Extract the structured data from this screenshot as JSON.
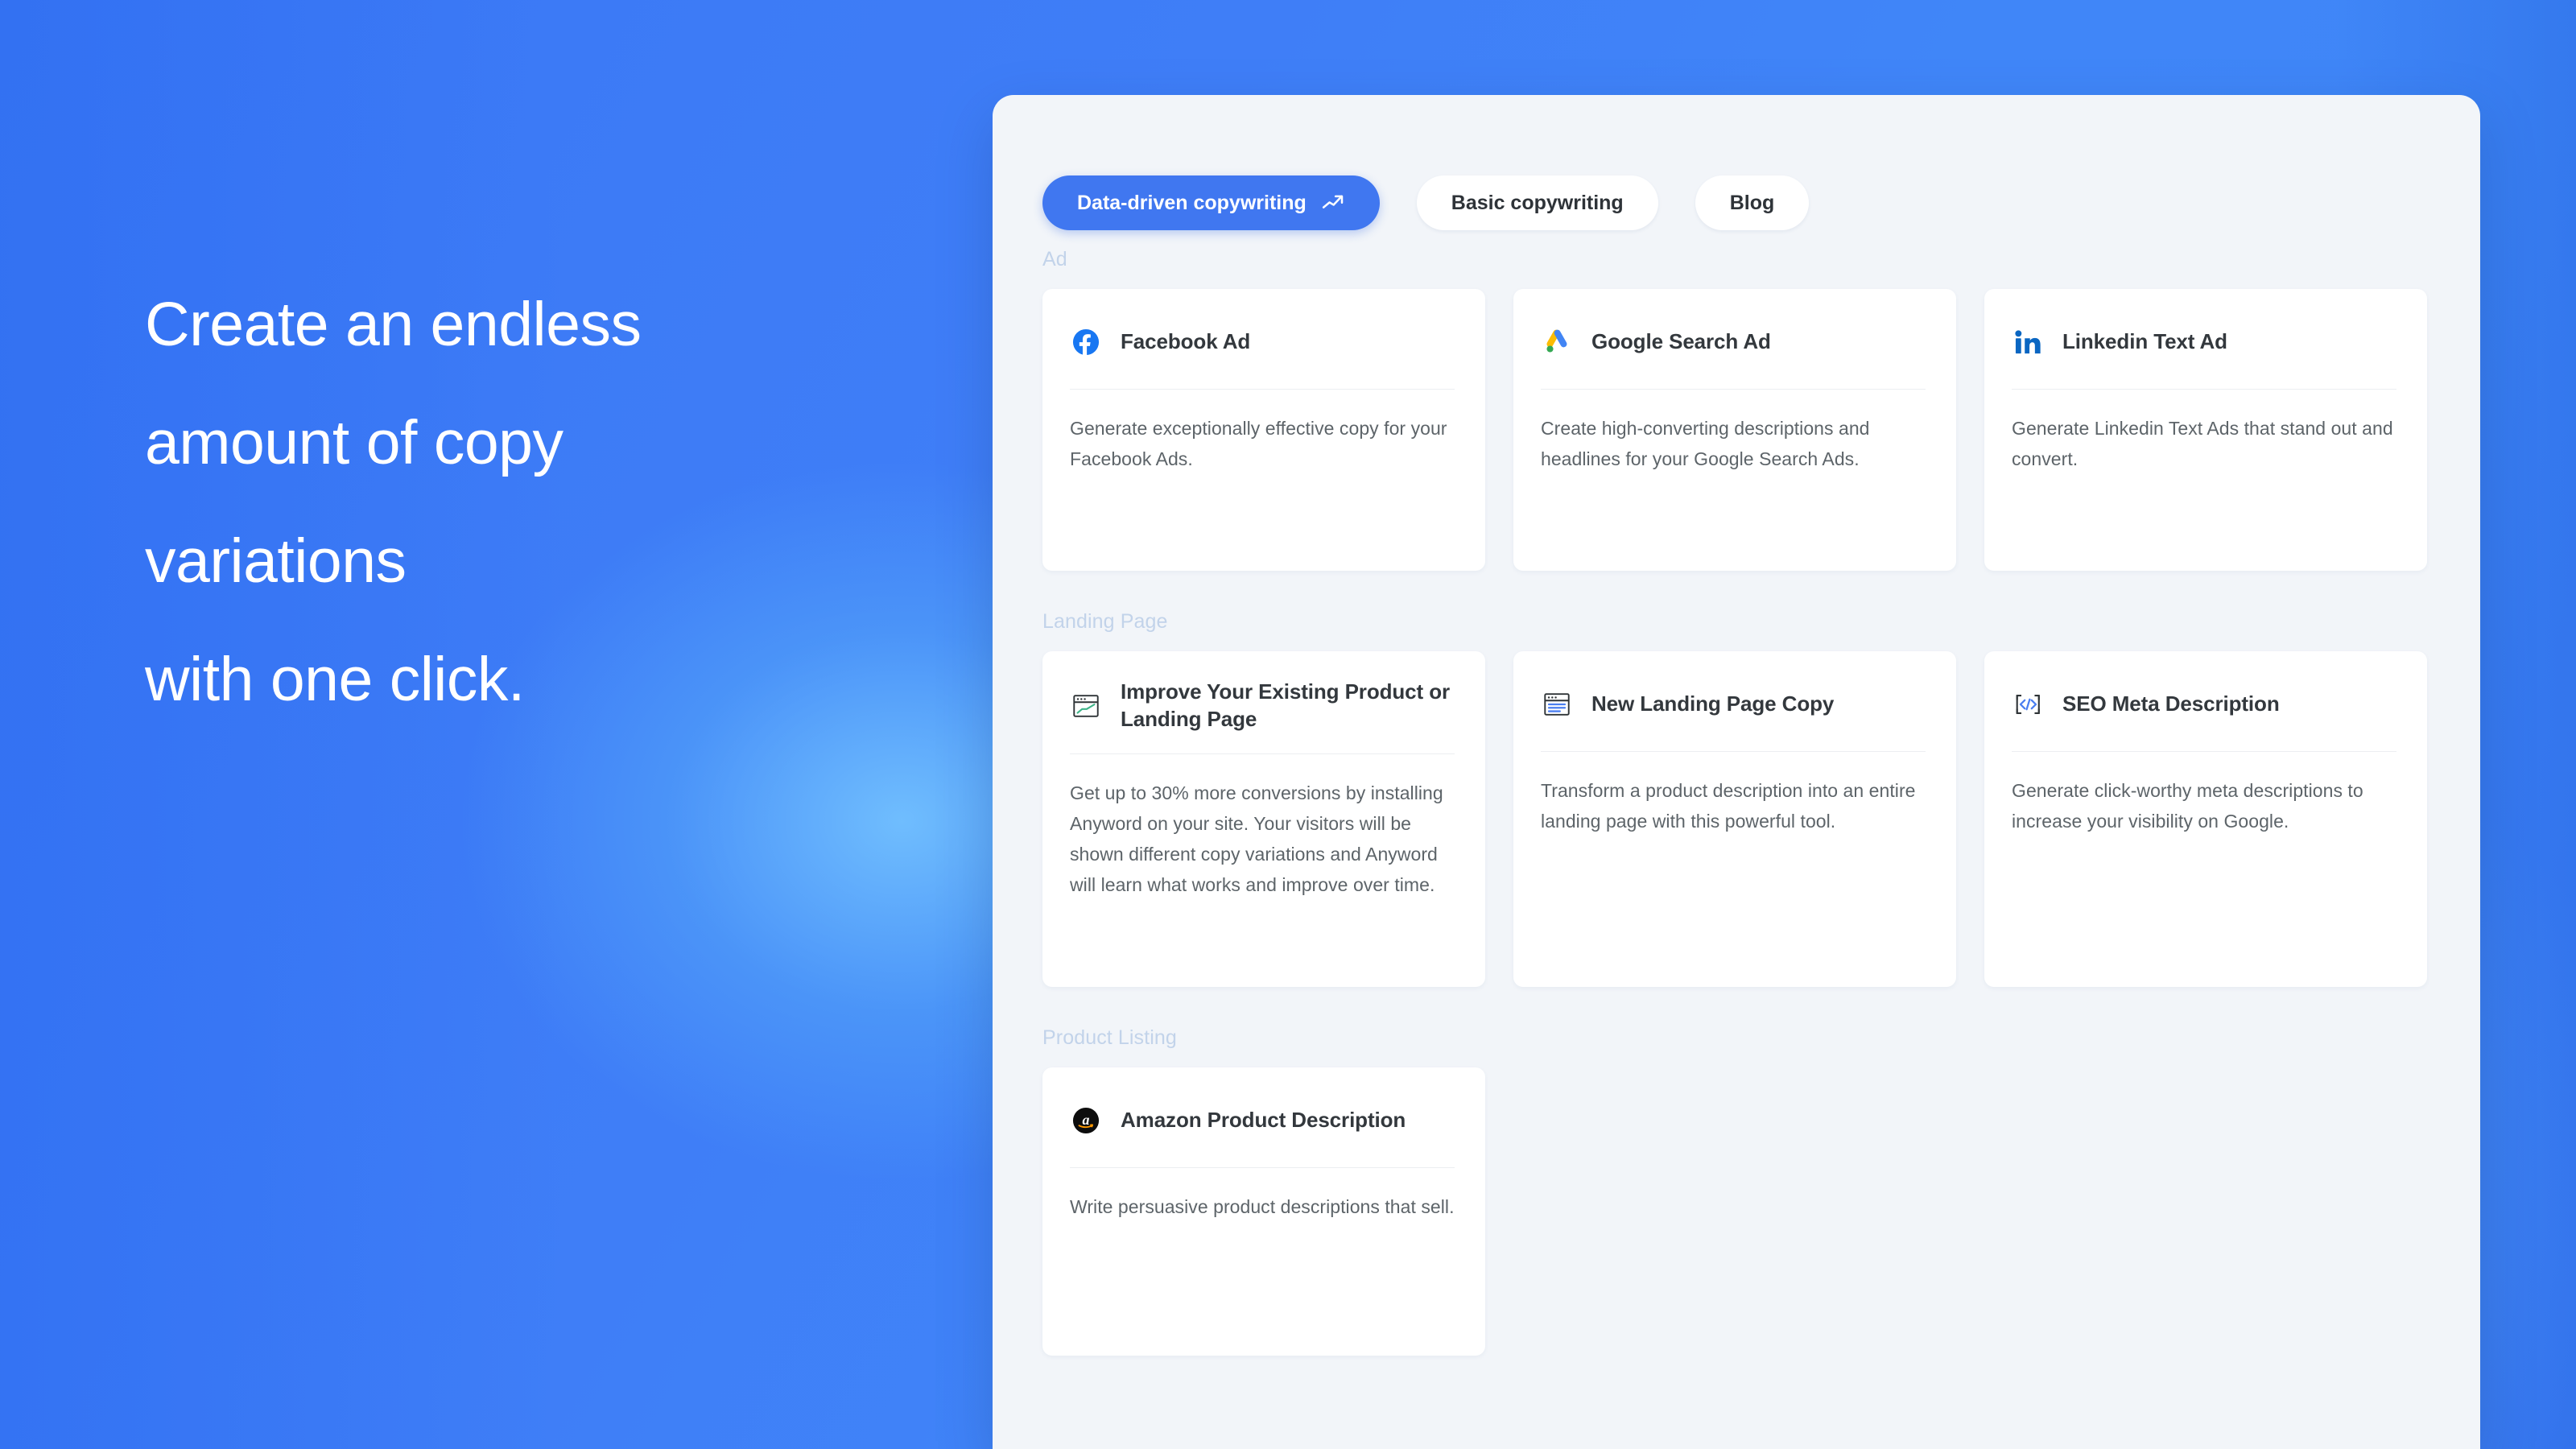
{
  "hero": {
    "lines": [
      "Create an endless",
      "amount of copy",
      "variations",
      "with one click."
    ]
  },
  "colors": {
    "brand_blue": "#4077f0",
    "background_blue": "#3c7cf6",
    "panel_bg": "#f2f5f9",
    "card_bg": "#ffffff",
    "section_label": "#c2d3ea",
    "title_text": "#33383d",
    "body_text": "#5d6469"
  },
  "panel": {
    "tabs": [
      {
        "label": "Data-driven copywriting",
        "icon": "trending-up-icon",
        "active": true
      },
      {
        "label": "Basic copywriting",
        "icon": "",
        "active": false
      },
      {
        "label": "Blog",
        "icon": "",
        "active": false
      }
    ],
    "sections": [
      {
        "label": "Ad",
        "cards": [
          {
            "icon": "facebook-icon",
            "title": "Facebook Ad",
            "description": "Generate exceptionally effective copy for your Facebook Ads."
          },
          {
            "icon": "google-ads-icon",
            "title": "Google Search Ad",
            "description": "Create high-converting descriptions and headlines for your Google Search Ads."
          },
          {
            "icon": "linkedin-icon",
            "title": "Linkedin Text Ad",
            "description": "Generate Linkedin Text Ads that stand out and convert."
          }
        ]
      },
      {
        "label": "Landing Page",
        "cards": [
          {
            "icon": "browser-chart-icon",
            "title": "Improve Your Existing Product or Landing Page",
            "description": "Get up to 30% more conversions by installing Anyword on your site. Your visitors will be shown different copy variations and Anyword will learn what works and improve over time."
          },
          {
            "icon": "browser-text-icon",
            "title": "New Landing Page Copy",
            "description": "Transform a product description into an entire landing page with this powerful tool."
          },
          {
            "icon": "code-brackets-icon",
            "title": "SEO Meta Description",
            "description": "Generate click-worthy meta descriptions to increase your visibility on Google."
          }
        ]
      },
      {
        "label": "Product Listing",
        "cards": [
          {
            "icon": "amazon-icon",
            "title": "Amazon Product Description",
            "description": "Write persuasive product descriptions that sell."
          }
        ]
      }
    ]
  }
}
